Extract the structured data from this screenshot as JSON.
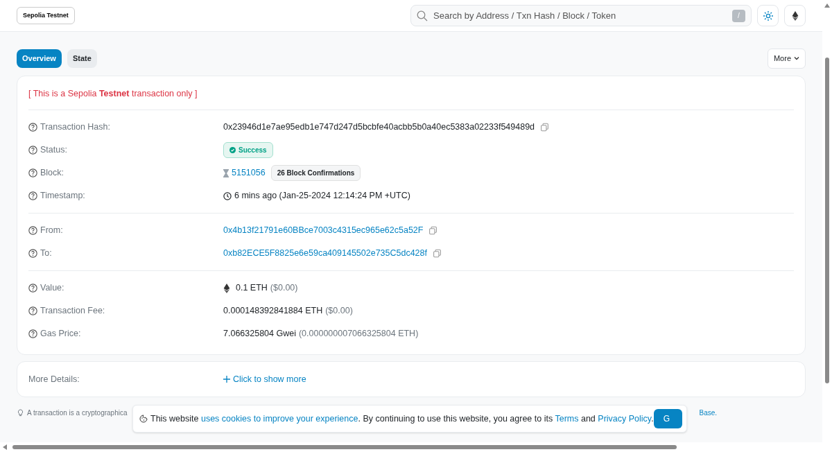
{
  "header": {
    "network_badge": "Sepolia Testnet",
    "search": {
      "placeholder": "Search by Address / Txn Hash / Block / Token",
      "shortcut": "/"
    }
  },
  "tabs": [
    {
      "label": "Overview",
      "selected": true
    },
    {
      "label": "State",
      "selected": false
    }
  ],
  "more_button": "More",
  "notice": "[ This is a Sepolia **Testnet** transaction only ]",
  "sections": [
    {
      "rows": [
        {
          "kind": "hash",
          "label": "Transaction Hash:",
          "value": "0x23946d1e7ae95edb1e747d247d5bcbfe40acbb5b0a40ec5383a02233f549489d"
        },
        {
          "kind": "status",
          "label": "Status:",
          "value": "Success"
        },
        {
          "kind": "block",
          "label": "Block:",
          "value": "5151056",
          "badge": "26 Block Confirmations"
        },
        {
          "kind": "timestamp",
          "label": "Timestamp:",
          "value": "6 mins ago (Jan-25-2024 12:14:24 PM +UTC)"
        }
      ]
    },
    {
      "rows": [
        {
          "kind": "address",
          "label": "From:",
          "value": "0x4b13f21791e60BBce7003c4315ec965e62c5a52F"
        },
        {
          "kind": "address",
          "label": "To:",
          "value": "0xb82ECE5F8825e6e59ca409145502e735C5dc428f"
        }
      ]
    },
    {
      "rows": [
        {
          "kind": "eth_amount",
          "label": "Value:",
          "value": "0.1 ETH",
          "secondary": "($0.00)"
        },
        {
          "kind": "amount",
          "label": "Transaction Fee:",
          "value": "0.000148392841884 ETH",
          "secondary": "($0.00)"
        },
        {
          "kind": "amount",
          "label": "Gas Price:",
          "value": "7.066325804 Gwei",
          "secondary": "(0.000000007066325804 ETH)"
        }
      ]
    }
  ],
  "more_details": {
    "label": "More Details:",
    "link": "Click to show more"
  },
  "footer": {
    "text": "A transaction is a cryptographica",
    "link": "Base."
  },
  "cookie_banner": {
    "parts": [
      {
        "kind": "text",
        "text": "This website"
      },
      {
        "kind": "link",
        "text": "uses cookies to improve your experience"
      },
      {
        "kind": "text",
        "text": ". By continuing to use this website, you agree to its"
      },
      {
        "kind": "link",
        "text": "Terms"
      },
      {
        "kind": "text",
        "text": "and"
      },
      {
        "kind": "link",
        "text": "Privacy Policy"
      },
      {
        "kind": "text",
        "text": "."
      }
    ],
    "button": "G"
  }
}
